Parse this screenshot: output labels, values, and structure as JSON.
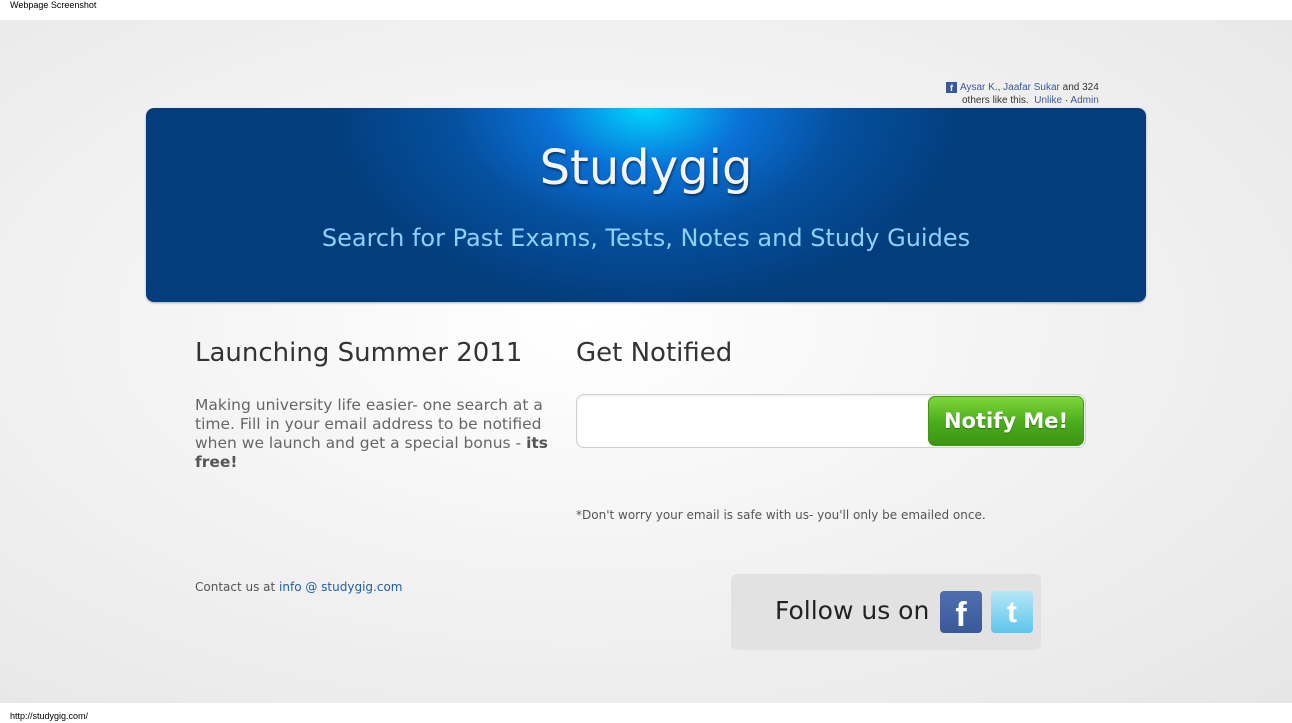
{
  "browser": {
    "caption": "Webpage Screenshot",
    "url": "http://studygig.com/"
  },
  "facebook_like": {
    "icon": "facebook-icon",
    "user1": "Aysar K.",
    "separator": ", ",
    "user2": "Jaafar Sukar",
    "count_text": " and 324",
    "others_text": "others like this.",
    "unlike_label": "Unlike",
    "dot": " · ",
    "admin_label": "Admin"
  },
  "banner": {
    "title": "Studygig",
    "subtitle": "Search for Past Exams, Tests, Notes and Study Guides"
  },
  "launch": {
    "heading": "Launching Summer 2011",
    "text": "Making university life easier- one search at a time. Fill in your email address to be notified when we launch and get a special bonus - ",
    "text_bold": "its free!"
  },
  "notify": {
    "heading": "Get Notified",
    "email_value": "",
    "email_placeholder": "",
    "button_label": "Notify Me!",
    "disclaimer": "*Don't worry your email is safe with us- you'll only be emailed once."
  },
  "contact": {
    "prefix": "Contact us at ",
    "email": "info @ studygig.com"
  },
  "follow": {
    "label": "Follow us on",
    "facebook_glyph": "f",
    "facebook_icon": "facebook-icon",
    "twitter_glyph": "t",
    "twitter_icon": "twitter-icon"
  },
  "colors": {
    "banner_blue": "#05509f",
    "banner_glow": "#00d6ff",
    "subtitle": "#8fd0ff",
    "button_green": "#4bab1c",
    "link_blue": "#1d5ea8"
  }
}
